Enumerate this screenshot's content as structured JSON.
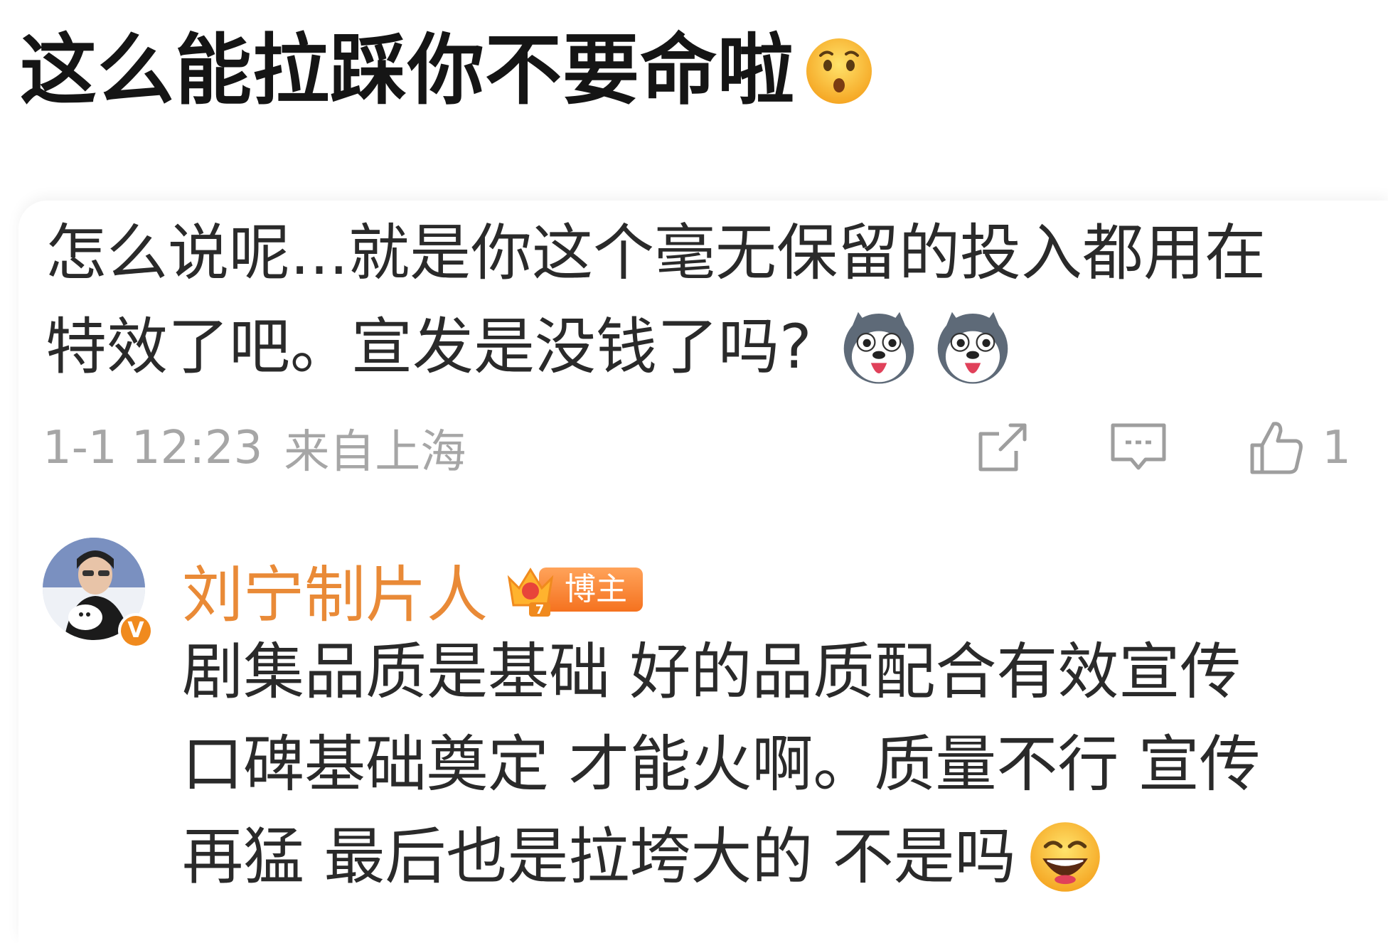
{
  "post": {
    "title": "这么能拉踩你不要命啦",
    "title_emoji": "surprised-face-emoji"
  },
  "comment": {
    "lines": [
      "怎么说呢...就是你这个毫无保留的投入都用在",
      "特效了吧。宣发是没钱了吗?"
    ],
    "emojis": [
      "husky-dog-emoji",
      "husky-dog-emoji"
    ],
    "timestamp": "1-1 12:23",
    "location": "来自上海",
    "like_count": "1",
    "icons": {
      "share": "share-icon",
      "reply": "comment-icon",
      "like": "thumbs-up-icon"
    }
  },
  "reply": {
    "username": "刘宁制片人",
    "badge_label": "博主",
    "badge_level": "7",
    "verified_mark": "V",
    "lines": [
      "剧集品质是基础 好的品质配合有效宣传",
      "口碑基础奠定 才能火啊。质量不行 宣传",
      "再猛 最后也是拉垮大的 不是吗"
    ],
    "end_emoji": "laughing-face-emoji"
  },
  "colors": {
    "username": "#e98a37",
    "meta_gray": "#a6a6a6",
    "text": "#2a2a2a",
    "badge_orange": "#f5721f"
  }
}
